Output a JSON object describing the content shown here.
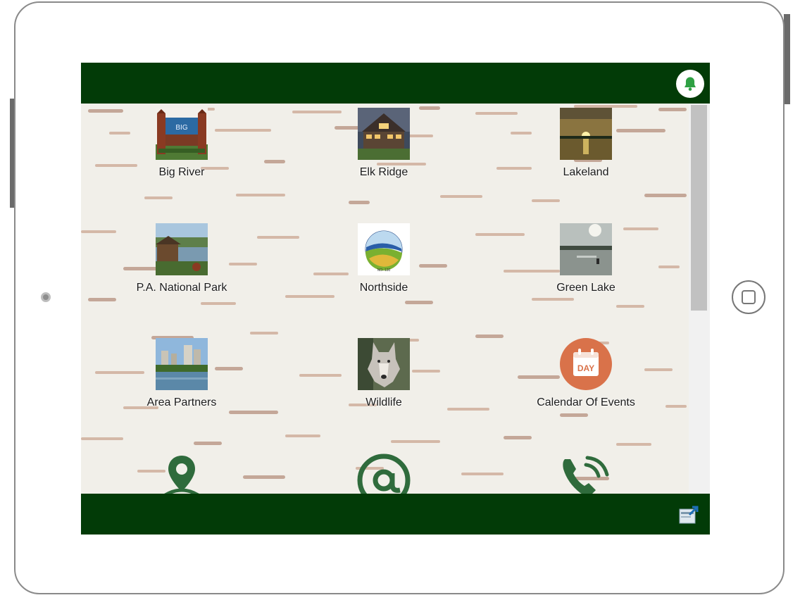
{
  "app": {
    "topbar": {
      "notification_icon": "bell-icon"
    },
    "tiles": [
      {
        "label": "Big River",
        "icon": "big-river-sign-photo"
      },
      {
        "label": "Elk Ridge",
        "icon": "elk-ridge-lodge-photo"
      },
      {
        "label": "Lakeland",
        "icon": "lakeland-sunset-photo"
      },
      {
        "label": "P.A. National Park",
        "icon": "national-park-photo"
      },
      {
        "label": "Northside",
        "icon": "northside-logo"
      },
      {
        "label": "Green Lake",
        "icon": "green-lake-photo"
      },
      {
        "label": "Area Partners",
        "icon": "area-partners-skyline-photo"
      },
      {
        "label": "Wildlife",
        "icon": "wildlife-wolf-photo"
      },
      {
        "label": "Calendar Of Events",
        "icon": "calendar-day-icon",
        "badge_text": "DAY"
      }
    ],
    "contacts": [
      {
        "icon": "map-pin-icon"
      },
      {
        "icon": "email-at-icon"
      },
      {
        "icon": "phone-icon"
      }
    ],
    "bottombar": {
      "share_icon": "share-icon"
    }
  },
  "colors": {
    "bar_green": "#023b07",
    "icon_green": "#2f6b3c",
    "calendar_orange": "#d9724a",
    "bark_pink": "#c9a590",
    "birch_white": "#f1efe9"
  }
}
